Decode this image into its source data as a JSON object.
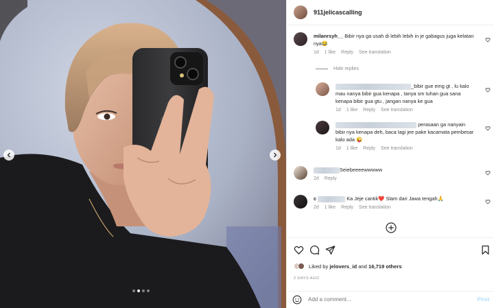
{
  "header": {
    "username": "911jelicascalling"
  },
  "photo": {
    "dots_total": 4,
    "active_dot": 1
  },
  "comments": [
    {
      "user": "milanrsyh__",
      "text": "Bibir nya ga usah di lebih lebih in je gabagus juga kelatan nya😂",
      "age": "1d",
      "likes": "1 like",
      "reply": "Reply",
      "translate": "See translation"
    },
    {
      "reply_toggle": "Hide replies"
    },
    {
      "user_hidden": true,
      "text": "_bibir gue emg gt , lu kalo mau nanya bibir gua kenapa , tanya sm tuhan gua sana kenapa bibir gua gtu , jangan nanya ke gua",
      "age": "1d",
      "likes": "1 like",
      "reply": "Reply",
      "translate": "See translation"
    },
    {
      "user_hidden": true,
      "text": "perasaan ga nanyain bibir nya kenapa deh, baca lagi jee pake kacamata pembesar kalo ada 😜",
      "age": "1d",
      "likes": "1 like",
      "reply": "Reply",
      "translate": "See translation"
    },
    {
      "user_hidden": true,
      "text": "Seiebeeeewwwww",
      "age": "2d",
      "reply": "Reply"
    },
    {
      "user_prefix": "c",
      "text": "Ka Jeje cantik❤️ Slam dari Jawa tengah🙏",
      "age": "2d",
      "likes": "1 like",
      "reply": "Reply",
      "translate": "See translation"
    }
  ],
  "likes_line": {
    "prefix": "Liked by",
    "user": "jelovers_id",
    "middle": "and",
    "count": "16,719 others"
  },
  "date": "2 DAYS AGO",
  "add_comment": {
    "placeholder": "Add a comment...",
    "post": "Post"
  },
  "icons": [
    "heart-icon",
    "comment-icon",
    "share-icon",
    "bookmark-icon",
    "emoji-icon",
    "add-circle-icon"
  ]
}
